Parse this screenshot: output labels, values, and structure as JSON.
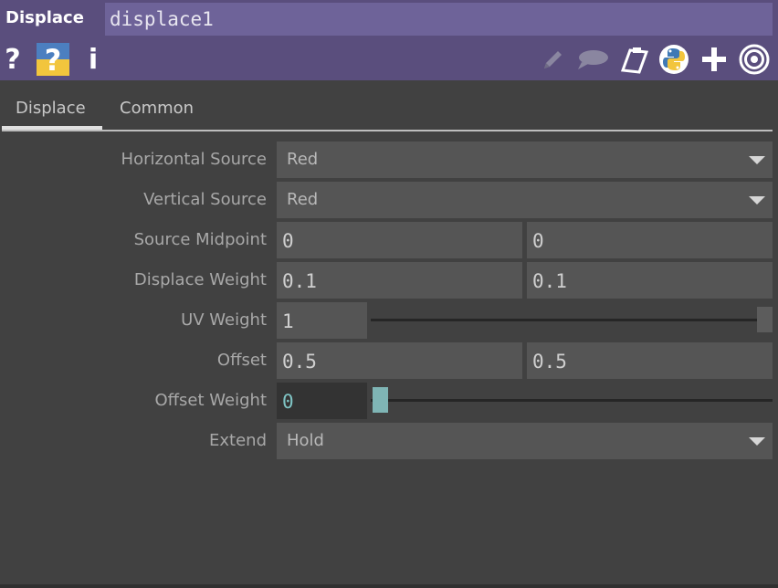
{
  "header": {
    "op_type": "Displace",
    "op_name": "displace1",
    "left_icons": [
      "help-icon",
      "op-help-icon",
      "info-icon"
    ],
    "right_icons": [
      "pencil-icon",
      "comment-icon",
      "clipboard-icon",
      "python-icon",
      "plus-icon",
      "target-icon"
    ]
  },
  "tabs": [
    {
      "label": "Displace",
      "active": true
    },
    {
      "label": "Common",
      "active": false
    }
  ],
  "params": {
    "horizontal_source": {
      "label": "Horizontal Source",
      "value": "Red"
    },
    "vertical_source": {
      "label": "Vertical Source",
      "value": "Red"
    },
    "source_midpoint": {
      "label": "Source Midpoint",
      "values": [
        "0",
        "0"
      ]
    },
    "displace_weight": {
      "label": "Displace Weight",
      "values": [
        "0.1",
        "0.1"
      ]
    },
    "uv_weight": {
      "label": "UV Weight",
      "value": "1",
      "slider_fraction": 1.0
    },
    "offset": {
      "label": "Offset",
      "values": [
        "0.5",
        "0.5"
      ]
    },
    "offset_weight": {
      "label": "Offset Weight",
      "value": "0",
      "slider_fraction": 0.0
    },
    "extend": {
      "label": "Extend",
      "value": "Hold"
    }
  },
  "colors": {
    "header_bg": "#5a4e7d",
    "name_field_bg": "#6e6399",
    "panel_bg": "#414141",
    "field_bg": "#555555",
    "active_value": "#7fc4c4",
    "slider_handle_active": "#7fb5b5",
    "slider_handle_idle": "#5c5c5c"
  }
}
